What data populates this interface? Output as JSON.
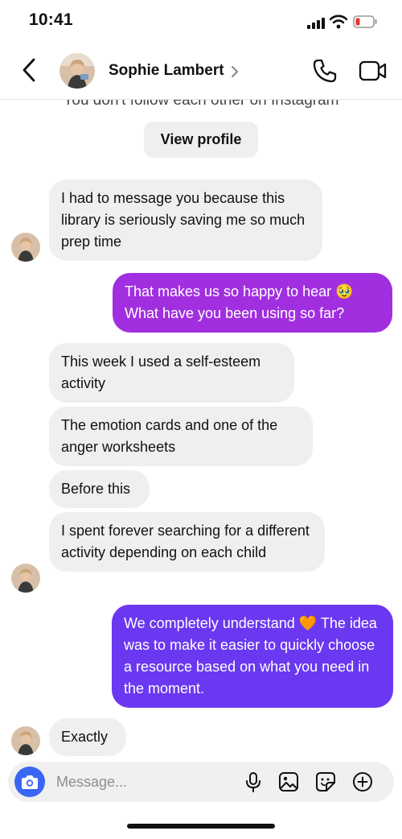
{
  "status": {
    "time": "10:41"
  },
  "header": {
    "contact_name": "Sophie Lambert"
  },
  "chat": {
    "follow_note": "You don't follow each other on Instagram",
    "view_profile_label": "View profile",
    "messages": [
      {
        "from": "them",
        "text": "I had to message you because this library is seriously saving me so much prep time"
      },
      {
        "from": "me",
        "text": "That makes us so happy to hear 🥹 What have you been using so far?"
      },
      {
        "from": "them",
        "text": "This week I used a self-esteem activity"
      },
      {
        "from": "them",
        "text": "The emotion cards and one of the anger worksheets"
      },
      {
        "from": "them",
        "text": "Before this"
      },
      {
        "from": "them",
        "text": "I spent forever searching for a different activity depending on each child"
      },
      {
        "from": "me",
        "text": "We completely understand 🧡 The idea was to make it easier to quickly choose a resource based on what you need in the moment."
      },
      {
        "from": "them",
        "text": "Exactly"
      }
    ]
  },
  "composer": {
    "placeholder": "Message..."
  },
  "colors": {
    "outgoing_1": "#a12fe0",
    "outgoing_2": "#6a38f0",
    "incoming": "#efefef",
    "camera_button": "#3a66f5"
  },
  "icons": [
    "back-icon",
    "chevron-right-icon",
    "phone-icon",
    "video-icon",
    "camera-icon",
    "microphone-icon",
    "gallery-icon",
    "sticker-icon",
    "plus-icon"
  ]
}
